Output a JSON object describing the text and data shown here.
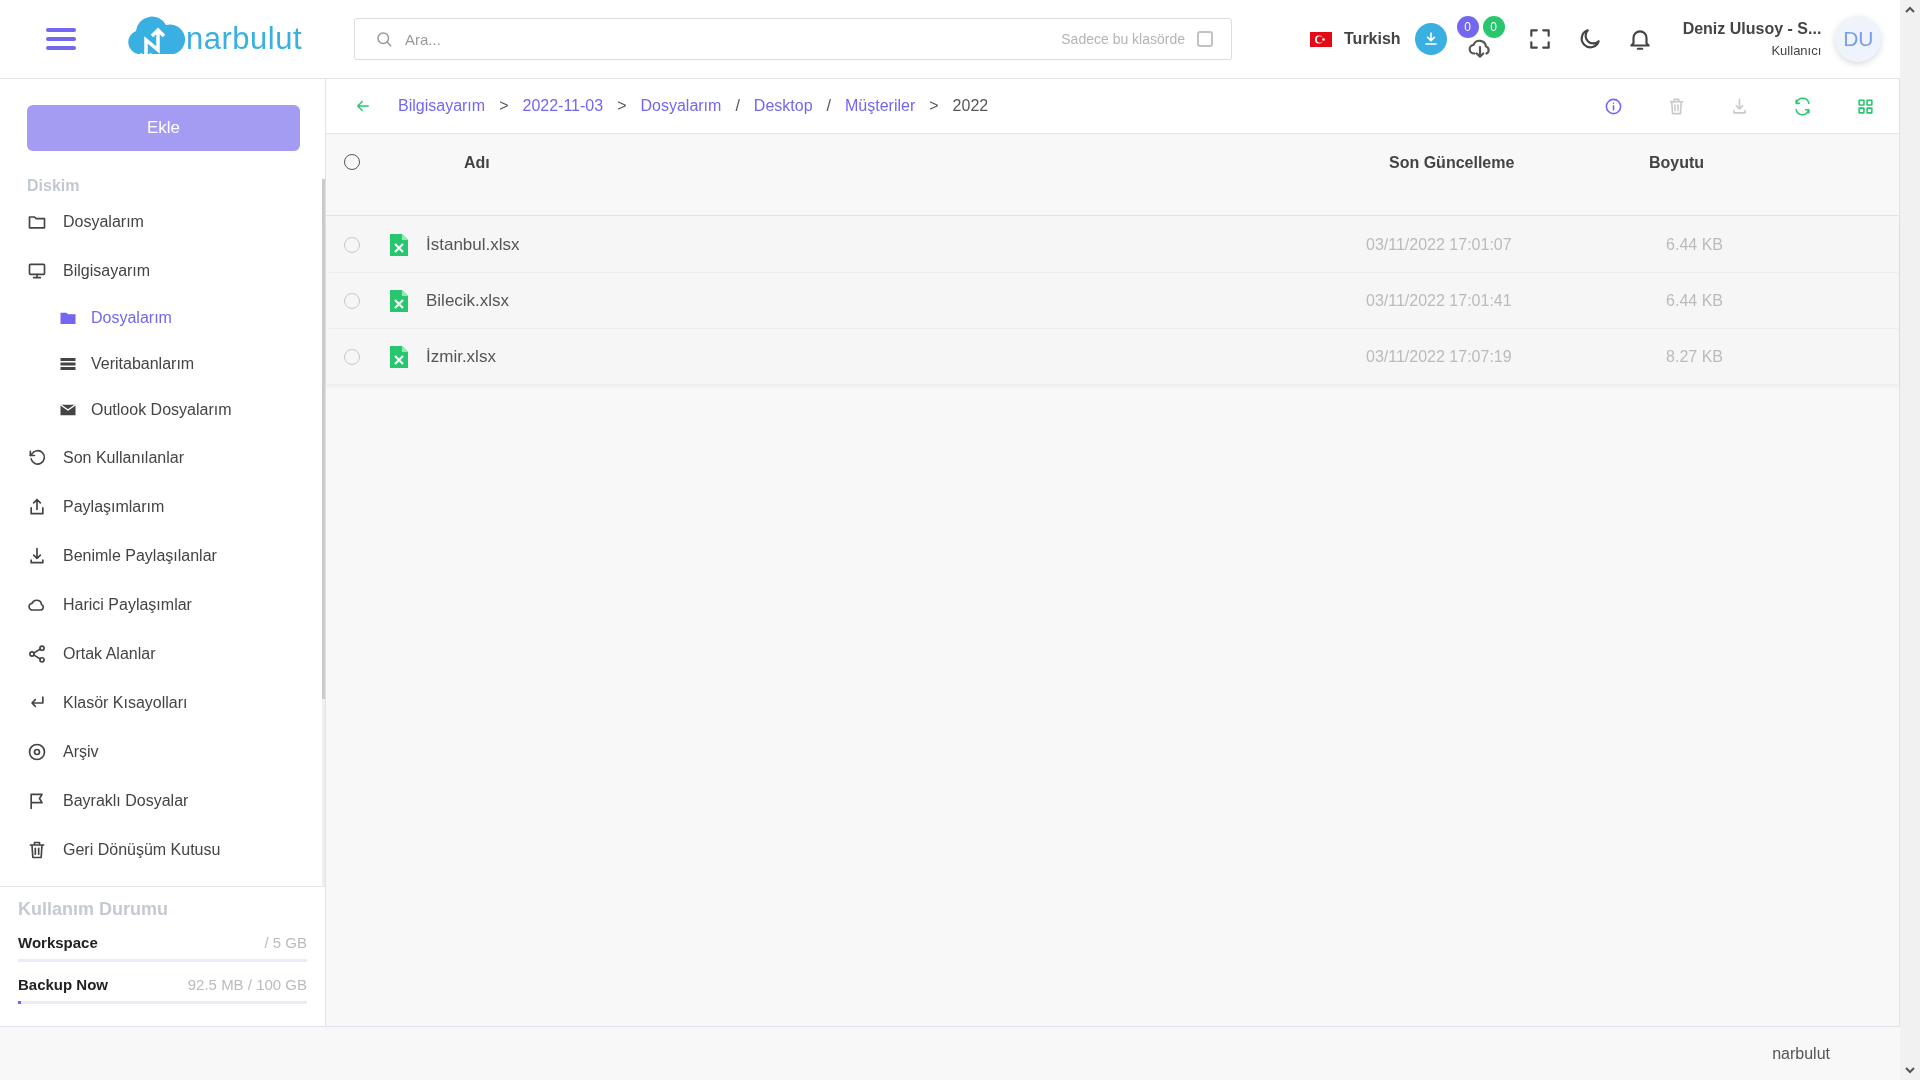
{
  "header": {
    "logo_text": "narbulut",
    "search": {
      "placeholder": "Ara...",
      "scope_label": "Sadece bu klasörde",
      "scope_checked": false
    },
    "language": "Turkish",
    "badges": [
      {
        "count": "0",
        "color": "#7367f0"
      },
      {
        "count": "0",
        "color": "#28c76f"
      }
    ],
    "user": {
      "name": "Deniz Ulusoy - S...",
      "role": "Kullanıcı",
      "initials": "DU"
    }
  },
  "sidebar": {
    "add_button": "Ekle",
    "section": "Diskim",
    "items": [
      {
        "label": "Dosyalarım",
        "selected": false
      },
      {
        "label": "Bilgisayarım",
        "selected": false,
        "children": [
          {
            "label": "Dosyalarım",
            "selected": true
          },
          {
            "label": "Veritabanlarım",
            "selected": false
          },
          {
            "label": "Outlook Dosyalarım",
            "selected": false
          }
        ]
      },
      {
        "label": "Son Kullanılanlar",
        "selected": false
      },
      {
        "label": "Paylaşımlarım",
        "selected": false
      },
      {
        "label": "Benimle Paylaşılanlar",
        "selected": false
      },
      {
        "label": "Harici Paylaşımlar",
        "selected": false
      },
      {
        "label": "Ortak Alanlar",
        "selected": false
      },
      {
        "label": "Klasör Kısayolları",
        "selected": false
      },
      {
        "label": "Arşiv",
        "selected": false
      },
      {
        "label": "Bayraklı Dosyalar",
        "selected": false
      },
      {
        "label": "Geri Dönüşüm Kutusu",
        "selected": false
      }
    ],
    "usage": {
      "title": "Kullanım Durumu",
      "meters": [
        {
          "name": "Workspace",
          "reading": "/ 5 GB",
          "level": 0
        },
        {
          "name": "Backup Now",
          "reading": "92.5 MB / 100 GB",
          "level": 0.01
        }
      ]
    }
  },
  "breadcrumb": [
    {
      "label": "Bilgisayarım",
      "sep": ">"
    },
    {
      "label": "2022-11-03",
      "sep": ">"
    },
    {
      "label": "Dosyalarım",
      "sep": "/"
    },
    {
      "label": "Desktop",
      "sep": "/"
    },
    {
      "label": "Müşteriler",
      "sep": ">"
    },
    {
      "label": "2022"
    }
  ],
  "toolbar": [
    {
      "disabled": false
    },
    {
      "disabled": true
    },
    {
      "disabled": true
    },
    {
      "disabled": false
    },
    {
      "disabled": false
    }
  ],
  "table": {
    "select_all": false,
    "columns": [
      "Adı",
      "Son Güncelleme",
      "Boyutu"
    ],
    "rows": [
      {
        "name": "İstanbul.xlsx",
        "updated": "03/11/2022 17:01:07",
        "size": "6.44 KB",
        "selected": false
      },
      {
        "name": "Bilecik.xlsx",
        "updated": "03/11/2022 17:01:41",
        "size": "6.44 KB",
        "selected": false
      },
      {
        "name": "İzmir.xlsx",
        "updated": "03/11/2022 17:07:19",
        "size": "8.27 KB",
        "selected": false
      }
    ]
  },
  "footer": {
    "text": "narbulut"
  }
}
